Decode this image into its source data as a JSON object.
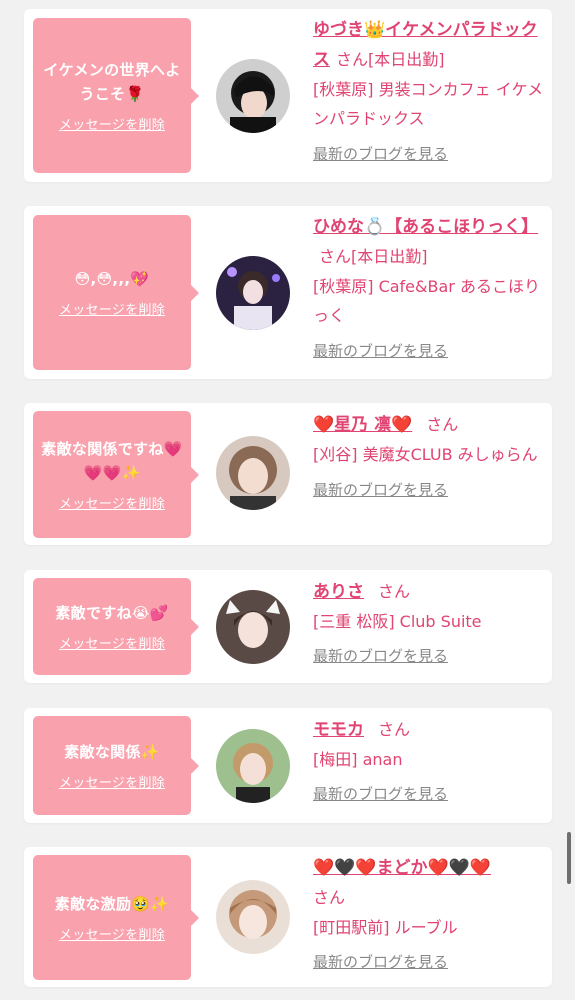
{
  "cards": [
    {
      "bubble_text": "イケメンの世界へようこそ🌹",
      "delete_label": "メッセージを削除",
      "name": "ゆづき👑イケメンパラドックス",
      "honorific": "さん",
      "status": "[本日出勤]",
      "shop": "[秋葉原] 男装コンカフェ イケメンパラドックス",
      "blog_label": "最新のブログを見る"
    },
    {
      "bubble_text": "😳,😳,,,💖",
      "delete_label": "メッセージを削除",
      "name": "ひめな💍【あるこほりっく】",
      "honorific": "さん",
      "status": "[本日出勤]",
      "shop": "[秋葉原] Cafe&Bar あるこほりっく",
      "blog_label": "最新のブログを見る"
    },
    {
      "bubble_text": "素敵な関係ですね💗💗💗✨",
      "delete_label": "メッセージを削除",
      "name": "❤️星乃 凛❤️",
      "honorific": "さん",
      "shop": "[刈谷] 美魔女CLUB みしゅらん",
      "blog_label": "最新のブログを見る"
    },
    {
      "bubble_text": "素敵ですね😭💕",
      "delete_label": "メッセージを削除",
      "name": "ありさ",
      "honorific": "さん",
      "shop": "[三重 松阪] Club Suite",
      "blog_label": "最新のブログを見る"
    },
    {
      "bubble_text": "素敵な関係✨",
      "delete_label": "メッセージを削除",
      "name": "モモカ",
      "honorific": "さん",
      "shop": "[梅田] anan",
      "blog_label": "最新のブログを見る"
    },
    {
      "bubble_text": "素敵な激励🥹✨",
      "delete_label": "メッセージを削除",
      "name": "❤️🖤❤️まどか❤️🖤❤️",
      "honorific": "さん",
      "shop": "[町田駅前] ルーブル",
      "blog_label": "最新のブログを見る"
    }
  ],
  "colors": {
    "bubble": "#f9a1ad",
    "accent_text": "#e04472",
    "link_gray": "#888888",
    "page_bg": "#f1f1f1"
  }
}
